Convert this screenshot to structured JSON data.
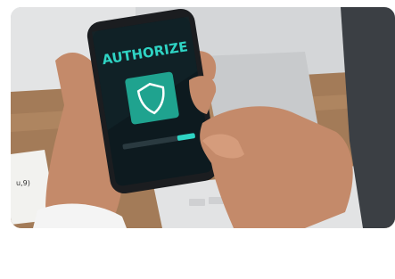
{
  "image": {
    "phone_headline": "AUTHORIZE",
    "paper_note": "u,9)",
    "colors": {
      "headline": "#2fd4c4",
      "screen": "#0d1a1f",
      "shield_tile": "#1fa38f",
      "desk": "#a37b58"
    },
    "icons": [
      "shield-icon"
    ]
  }
}
